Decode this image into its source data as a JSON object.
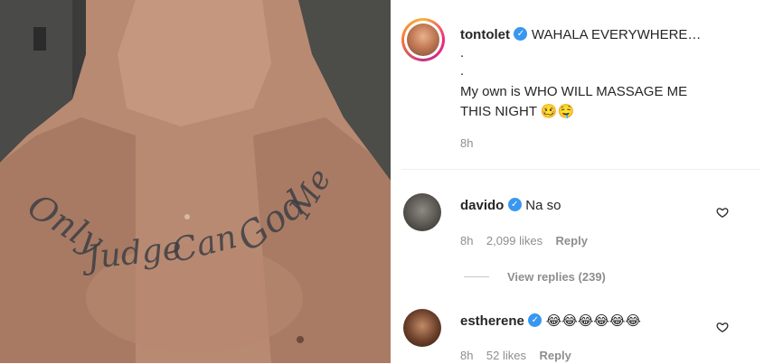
{
  "photo": {
    "tattoo_words": [
      "Only",
      "Judge",
      "Can",
      "God",
      "Me"
    ]
  },
  "post": {
    "username": "tontolet",
    "verified_icon": "verified-badge-icon",
    "caption_line1": "WAHALA EVERYWHERE…",
    "dot1": ".",
    "dot2": ".",
    "caption_line2": "My own is WHO WILL MASSAGE ME",
    "caption_line3": "THIS NIGHT",
    "caption_emojis": "🥴🤤",
    "time": "8h"
  },
  "comments": [
    {
      "username": "davido",
      "text": "Na so",
      "time": "8h",
      "likes": "2,099 likes",
      "reply_label": "Reply",
      "view_replies": "View replies (239)"
    },
    {
      "username": "estherene",
      "text": "😂😂😂😂😂😂",
      "time": "8h",
      "likes": "52 likes",
      "reply_label": "Reply"
    }
  ],
  "colors": {
    "verified": "#3897f0",
    "muted": "#8e8e8e",
    "text": "#262626"
  }
}
